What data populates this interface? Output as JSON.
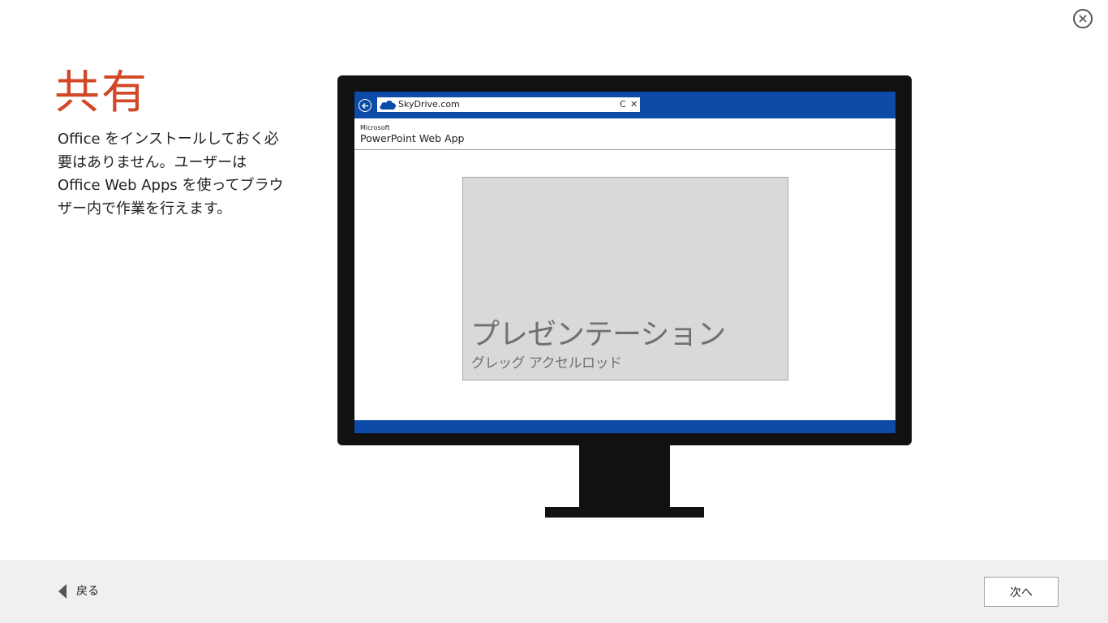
{
  "header": {
    "close_icon": "close-circle-icon"
  },
  "intro": {
    "title": "共有",
    "description": "Office をインストールしておく必要はありません。ユーザーは Office Web Apps を使ってブラウザー内で作業を行えます。"
  },
  "illustration": {
    "browser": {
      "back_icon": "back-arrow-icon",
      "site_icon": "skydrive-cloud-icon",
      "url": "SkyDrive.com",
      "refresh_glyph": "C",
      "stop_glyph": "✕"
    },
    "app": {
      "brand": "Microsoft",
      "name": "PowerPoint Web App"
    },
    "slide": {
      "title": "プレゼンテーション",
      "subtitle": "グレッグ アクセルロッド"
    }
  },
  "footer": {
    "back_label": "戻る",
    "next_label": "次へ"
  },
  "colors": {
    "accent": "#d24726",
    "browser_blue": "#0c4ba8",
    "footer_bg": "#f0f0f0"
  }
}
